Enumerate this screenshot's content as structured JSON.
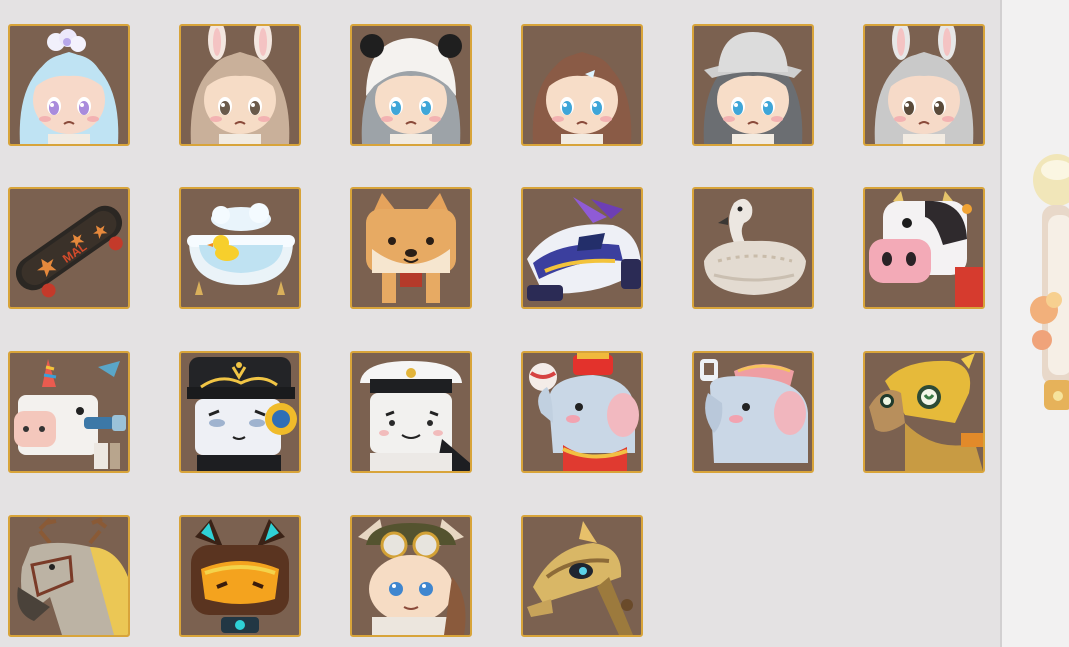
{
  "colors": {
    "tile_bg": "#7b6150",
    "tile_border": "#d8a43a",
    "page_bg": "#e4e2e3",
    "side_bg": "#f2f1f1"
  },
  "rows": [
    {
      "items": [
        {
          "icon": "blue-hair-girl-avatar-icon",
          "skin": "#f7d9c9",
          "hair": "#bfe3f3",
          "extra": "flower",
          "eye": "#a98bdc"
        },
        {
          "icon": "bunny-ear-girl-avatar-icon",
          "skin": "#f6dcc6",
          "hair": "#c9b09a",
          "extra": "bunny",
          "eye": "#6a5a4a"
        },
        {
          "icon": "panda-hood-girl-avatar-icon",
          "skin": "#f7ddc8",
          "hair": "#9da3a8",
          "extra": "panda",
          "eye": "#3fa6d8"
        },
        {
          "icon": "brown-hair-girl-avatar-icon",
          "skin": "#f7ddc8",
          "hair": "#8a5b46",
          "extra": "clip",
          "eye": "#3fa6d8"
        },
        {
          "icon": "bucket-hat-girl-avatar-icon",
          "skin": "#f7ddc8",
          "hair": "#6b6e72",
          "extra": "hat",
          "eye": "#3fa6d8"
        },
        {
          "icon": "silver-bunny-girl-avatar-icon",
          "skin": "#f6dac8",
          "hair": "#c9c9c9",
          "extra": "bunny-grey",
          "eye": "#5a4a3a"
        }
      ]
    },
    {
      "items": [
        {
          "icon": "skateboard-icon"
        },
        {
          "icon": "bathtub-duck-icon"
        },
        {
          "icon": "shiba-dog-mount-icon"
        },
        {
          "icon": "race-car-mount-icon"
        },
        {
          "icon": "swan-boat-icon"
        },
        {
          "icon": "cow-mount-icon"
        }
      ]
    },
    {
      "items": [
        {
          "icon": "unicorn-cow-mount-icon"
        },
        {
          "icon": "captain-cat-goggles-icon"
        },
        {
          "icon": "sailor-cat-icon"
        },
        {
          "icon": "circus-elephant-ball-icon"
        },
        {
          "icon": "elephant-mount-icon"
        },
        {
          "icon": "golden-parrot-mount-icon"
        }
      ]
    },
    {
      "items": [
        {
          "icon": "reindeer-horse-mount-icon"
        },
        {
          "icon": "cyber-fox-visor-icon"
        },
        {
          "icon": "aviator-fox-goggles-icon"
        },
        {
          "icon": "mecha-horse-mount-icon"
        }
      ]
    }
  ],
  "side_preview": {
    "icon": "character-preview-partial-icon"
  }
}
